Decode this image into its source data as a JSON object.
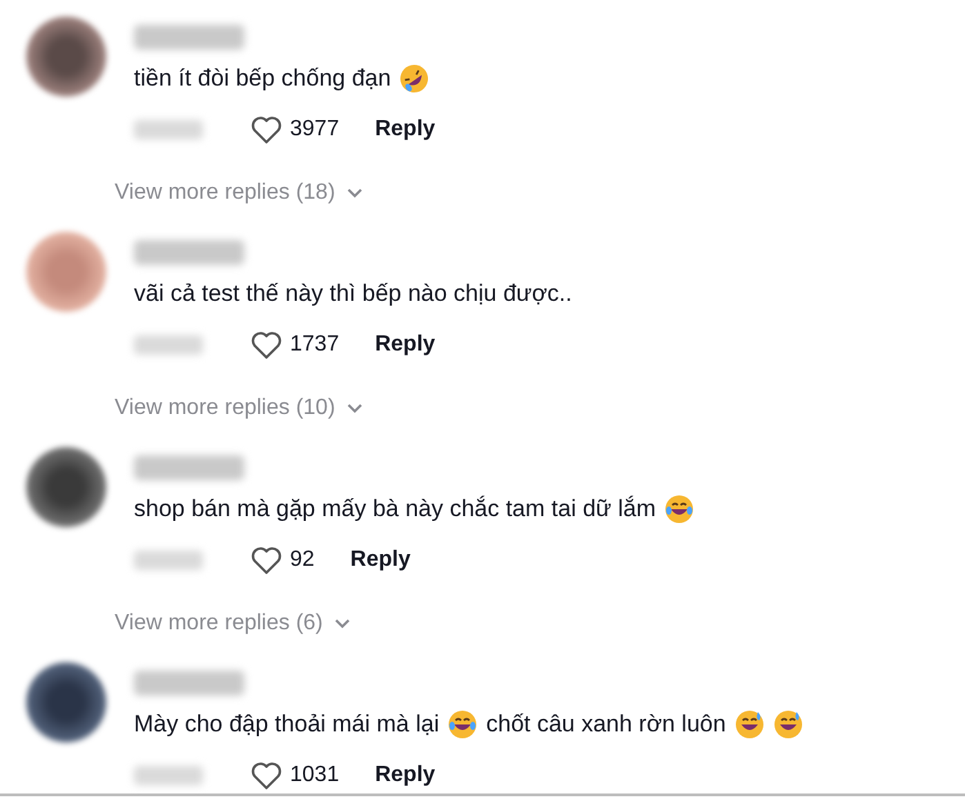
{
  "comments": [
    {
      "body": [
        {
          "kind": "text",
          "text": "tiền ít đòi bếp chống đạn"
        },
        {
          "kind": "rolling-laugh"
        }
      ],
      "likes": "3977",
      "reply": "Reply",
      "more": {
        "label": "View more replies (18)"
      }
    },
    {
      "body": [
        {
          "kind": "text",
          "text": "vãi cả test thế này thì bếp nào chịu được.."
        }
      ],
      "likes": "1737",
      "reply": "Reply",
      "more": {
        "label": "View more replies (10)"
      }
    },
    {
      "body": [
        {
          "kind": "text",
          "text": "shop bán mà gặp mấy bà này chắc tam tai dữ lắm"
        },
        {
          "kind": "laugh-tears"
        }
      ],
      "likes": "92",
      "reply": "Reply",
      "more": {
        "label": "View more replies (6)"
      }
    },
    {
      "body": [
        {
          "kind": "text",
          "text": "Mày cho đập thoải mái mà lại"
        },
        {
          "kind": "laugh-tears"
        },
        {
          "kind": "text",
          "text": "chốt câu xanh rờn luôn"
        },
        {
          "kind": "sweat-smile"
        },
        {
          "kind": "sweat-smile"
        }
      ],
      "likes": "1031",
      "reply": "Reply"
    }
  ]
}
